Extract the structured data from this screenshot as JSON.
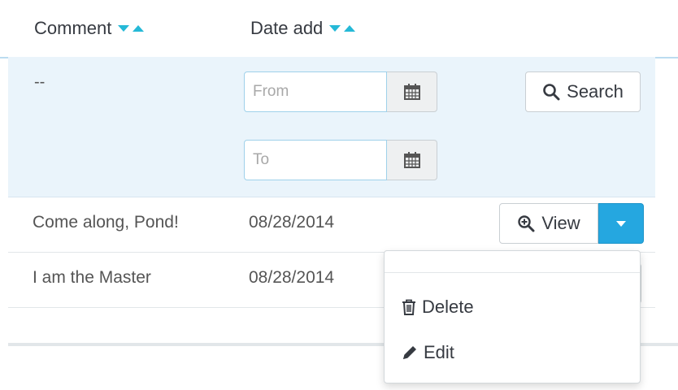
{
  "header": {
    "columns": [
      {
        "label": "Comment"
      },
      {
        "label": "Date add"
      }
    ]
  },
  "filter": {
    "comment_value": "--",
    "from_placeholder": "From",
    "to_placeholder": "To",
    "search_label": "Search"
  },
  "rows": [
    {
      "comment": "Come along, Pond!",
      "date": "08/28/2014",
      "action_label": "View"
    },
    {
      "comment": "I am the Master",
      "date": "08/28/2014"
    }
  ],
  "dropdown": {
    "items": [
      {
        "label": "Delete",
        "icon": "trash-icon"
      },
      {
        "label": "Edit",
        "icon": "pencil-icon"
      }
    ]
  },
  "colors": {
    "accent": "#25b9d7",
    "primary_button": "#25a7e0",
    "filter_bg": "#eaf4fb"
  }
}
